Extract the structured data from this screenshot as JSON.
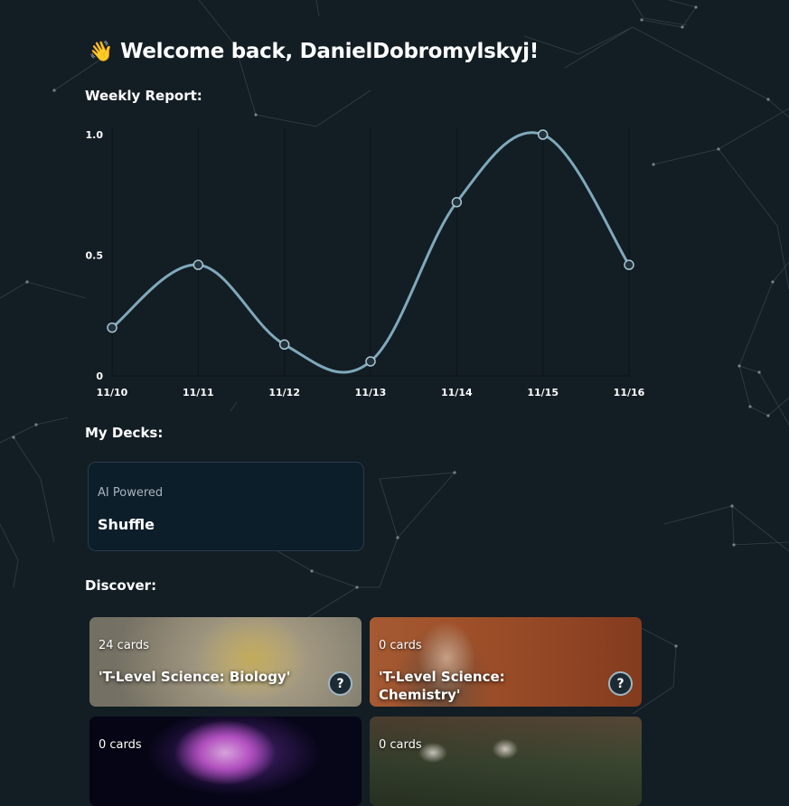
{
  "welcome": {
    "emoji": "👋",
    "text": "Welcome back, DanielDobromylskyj!"
  },
  "sections": {
    "weekly_report": "Weekly Report:",
    "my_decks": "My Decks:",
    "discover": "Discover:"
  },
  "chart_data": {
    "type": "line",
    "title": "",
    "xlabel": "",
    "ylabel": "",
    "categories": [
      "11/10",
      "11/11",
      "11/12",
      "11/13",
      "11/14",
      "11/15",
      "11/16"
    ],
    "series": [
      {
        "values": [
          0.2,
          0.46,
          0.13,
          0.06,
          0.72,
          1.0,
          0.46
        ]
      }
    ],
    "yticks": [
      "0",
      "0.5",
      "1.0"
    ],
    "ylim": [
      0,
      1
    ],
    "grid": "vertical",
    "line_color": "#7fa9bb"
  },
  "decks": [
    {
      "tag": "AI Powered",
      "name": "Shuffle"
    }
  ],
  "discover": [
    {
      "count": "24 cards",
      "title": "'T-Level Science: Biology'",
      "help": "?"
    },
    {
      "count": "0 cards",
      "title": "'T-Level Science: Chemistry'",
      "help": "?"
    },
    {
      "count": "0 cards",
      "title": "",
      "help": ""
    },
    {
      "count": "0 cards",
      "title": "",
      "help": ""
    }
  ],
  "colors": {
    "background": "#131d24",
    "deck_card": "#0d1e2b",
    "chart_line": "#7fa9bb"
  }
}
